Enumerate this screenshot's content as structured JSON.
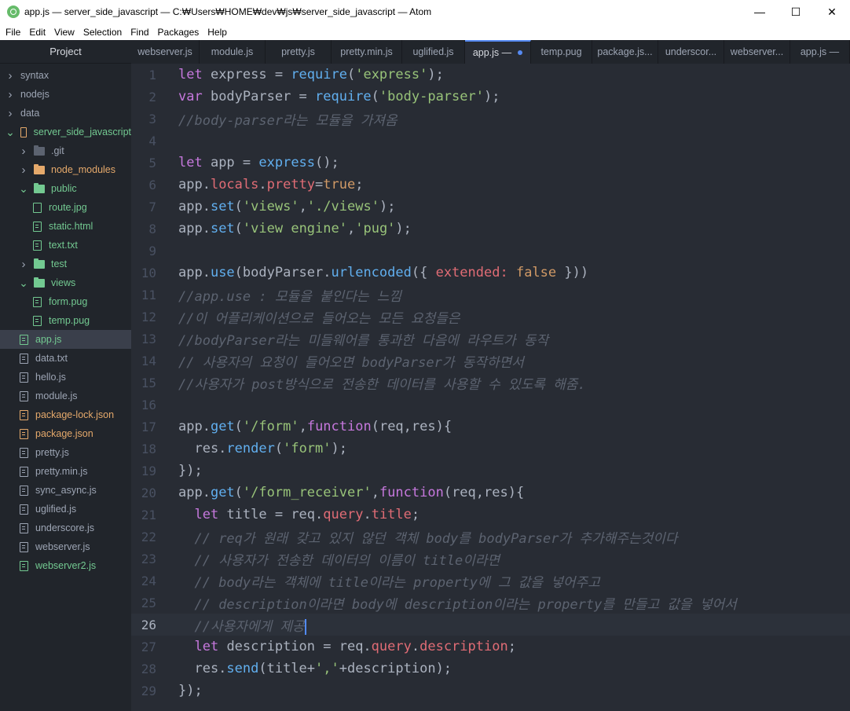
{
  "window": {
    "title": "app.js — server_side_javascript — C:₩Users₩HOME₩dev₩js₩server_side_javascript — Atom",
    "minimize": "—",
    "maximize": "☐",
    "close": "✕"
  },
  "menu": [
    "File",
    "Edit",
    "View",
    "Selection",
    "Find",
    "Packages",
    "Help"
  ],
  "tree": {
    "header": "Project",
    "items": [
      {
        "label": "syntax",
        "depth": 0,
        "type": "folder",
        "expanded": false
      },
      {
        "label": "nodejs",
        "depth": 0,
        "type": "folder",
        "expanded": false
      },
      {
        "label": "data",
        "depth": 0,
        "type": "folder",
        "expanded": false
      },
      {
        "label": "server_side_javascript",
        "depth": 0,
        "type": "repo",
        "expanded": true
      },
      {
        "label": ".git",
        "depth": 1,
        "type": "folder",
        "expanded": false
      },
      {
        "label": "node_modules",
        "depth": 1,
        "type": "folder",
        "expanded": false
      },
      {
        "label": "public",
        "depth": 1,
        "type": "folder",
        "expanded": true
      },
      {
        "label": "route.jpg",
        "depth": 2,
        "type": "image"
      },
      {
        "label": "static.html",
        "depth": 2,
        "type": "file"
      },
      {
        "label": "text.txt",
        "depth": 2,
        "type": "file"
      },
      {
        "label": "test",
        "depth": 1,
        "type": "folder",
        "expanded": false
      },
      {
        "label": "views",
        "depth": 1,
        "type": "folder",
        "expanded": true
      },
      {
        "label": "form.pug",
        "depth": 2,
        "type": "file"
      },
      {
        "label": "temp.pug",
        "depth": 2,
        "type": "file"
      },
      {
        "label": "app.js",
        "depth": 1,
        "type": "file",
        "selected": true
      },
      {
        "label": "data.txt",
        "depth": 1,
        "type": "file"
      },
      {
        "label": "hello.js",
        "depth": 1,
        "type": "file"
      },
      {
        "label": "module.js",
        "depth": 1,
        "type": "file"
      },
      {
        "label": "package-lock.json",
        "depth": 1,
        "type": "file"
      },
      {
        "label": "package.json",
        "depth": 1,
        "type": "file"
      },
      {
        "label": "pretty.js",
        "depth": 1,
        "type": "file"
      },
      {
        "label": "pretty.min.js",
        "depth": 1,
        "type": "file"
      },
      {
        "label": "sync_async.js",
        "depth": 1,
        "type": "file"
      },
      {
        "label": "uglified.js",
        "depth": 1,
        "type": "file"
      },
      {
        "label": "underscore.js",
        "depth": 1,
        "type": "file"
      },
      {
        "label": "webserver.js",
        "depth": 1,
        "type": "file"
      },
      {
        "label": "webserver2.js",
        "depth": 1,
        "type": "file"
      }
    ]
  },
  "tabs": [
    {
      "label": "webserver.js"
    },
    {
      "label": "module.js"
    },
    {
      "label": "pretty.js"
    },
    {
      "label": "pretty.min.js"
    },
    {
      "label": "uglified.js"
    },
    {
      "label": "app.js —",
      "active": true,
      "modified": true
    },
    {
      "label": "temp.pug"
    },
    {
      "label": "package.js..."
    },
    {
      "label": "underscor..."
    },
    {
      "label": "webserver..."
    },
    {
      "label": "app.js —"
    }
  ],
  "colors": {
    "keyword": "#c678dd",
    "function": "#61afef",
    "string": "#98c379",
    "property": "#e06c75",
    "boolean": "#d19a66",
    "comment": "#5c6370",
    "folder_green": "#73c991",
    "folder_orange": "#e5a96b",
    "accent": "#568af2"
  },
  "cursor_line": 26,
  "code": [
    [
      [
        "kw",
        "let"
      ],
      [
        "t",
        " express = "
      ],
      [
        "fn",
        "require"
      ],
      [
        "t",
        "("
      ],
      [
        "str",
        "'express'"
      ],
      [
        "t",
        ");"
      ]
    ],
    [
      [
        "kw",
        "var"
      ],
      [
        "t",
        " bodyParser = "
      ],
      [
        "fn",
        "require"
      ],
      [
        "t",
        "("
      ],
      [
        "str",
        "'body-parser'"
      ],
      [
        "t",
        ");"
      ]
    ],
    [
      [
        "cm",
        "//body-parser라는 모듈을 가져옴"
      ]
    ],
    [],
    [
      [
        "kw",
        "let"
      ],
      [
        "t",
        " app = "
      ],
      [
        "fn",
        "express"
      ],
      [
        "t",
        "();"
      ]
    ],
    [
      [
        "t",
        "app."
      ],
      [
        "prop",
        "locals"
      ],
      [
        "t",
        "."
      ],
      [
        "prop",
        "pretty"
      ],
      [
        "t",
        "="
      ],
      [
        "bool",
        "true"
      ],
      [
        "t",
        ";"
      ]
    ],
    [
      [
        "t",
        "app."
      ],
      [
        "fn",
        "set"
      ],
      [
        "t",
        "("
      ],
      [
        "str",
        "'views'"
      ],
      [
        "t",
        ","
      ],
      [
        "str",
        "'./views'"
      ],
      [
        "t",
        ");"
      ]
    ],
    [
      [
        "t",
        "app."
      ],
      [
        "fn",
        "set"
      ],
      [
        "t",
        "("
      ],
      [
        "str",
        "'view engine'"
      ],
      [
        "t",
        ","
      ],
      [
        "str",
        "'pug'"
      ],
      [
        "t",
        ");"
      ]
    ],
    [],
    [
      [
        "t",
        "app."
      ],
      [
        "fn",
        "use"
      ],
      [
        "t",
        "(bodyParser."
      ],
      [
        "fn",
        "urlencoded"
      ],
      [
        "t",
        "({ "
      ],
      [
        "prop",
        "extended:"
      ],
      [
        "t",
        " "
      ],
      [
        "bool",
        "false"
      ],
      [
        "t",
        " }))"
      ]
    ],
    [
      [
        "cm",
        "//app.use : 모듈을 붙인다는 느낌"
      ]
    ],
    [
      [
        "cm",
        "//이 어플리케이션으로 들어오는 모든 요청들은"
      ]
    ],
    [
      [
        "cm",
        "//bodyParser라는 미들웨어를 통과한 다음에 라우트가 동작"
      ]
    ],
    [
      [
        "cm",
        "// 사용자의 요청이 들어오면 bodyParser가 동작하면서"
      ]
    ],
    [
      [
        "cm",
        "//사용자가 post방식으로 전송한 데이터를 사용할 수 있도록 해줌."
      ]
    ],
    [],
    [
      [
        "t",
        "app."
      ],
      [
        "fn",
        "get"
      ],
      [
        "t",
        "("
      ],
      [
        "str",
        "'/form'"
      ],
      [
        "t",
        ","
      ],
      [
        "kw",
        "function"
      ],
      [
        "t",
        "(req,res){"
      ]
    ],
    [
      [
        "t",
        "  res."
      ],
      [
        "fn",
        "render"
      ],
      [
        "t",
        "("
      ],
      [
        "str",
        "'form'"
      ],
      [
        "t",
        ");"
      ]
    ],
    [
      [
        "t",
        "});"
      ]
    ],
    [
      [
        "t",
        "app."
      ],
      [
        "fn",
        "get"
      ],
      [
        "t",
        "("
      ],
      [
        "str",
        "'/form_receiver'"
      ],
      [
        "t",
        ","
      ],
      [
        "kw",
        "function"
      ],
      [
        "t",
        "(req,res){"
      ]
    ],
    [
      [
        "t",
        "  "
      ],
      [
        "kw",
        "let"
      ],
      [
        "t",
        " title = req."
      ],
      [
        "prop",
        "query"
      ],
      [
        "t",
        "."
      ],
      [
        "prop",
        "title"
      ],
      [
        "t",
        ";"
      ]
    ],
    [
      [
        "t",
        "  "
      ],
      [
        "cm",
        "// req가 원래 갖고 있지 않던 객체 body를 bodyParser가 추가해주는것이다"
      ]
    ],
    [
      [
        "t",
        "  "
      ],
      [
        "cm",
        "// 사용자가 전송한 데이터의 이름이 title이라면"
      ]
    ],
    [
      [
        "t",
        "  "
      ],
      [
        "cm",
        "// body라는 객체에 title이라는 property에 그 값을 넣어주고"
      ]
    ],
    [
      [
        "t",
        "  "
      ],
      [
        "cm",
        "// description이라면 body에 description이라는 property를 만들고 값을 넣어서"
      ]
    ],
    [
      [
        "t",
        "  "
      ],
      [
        "cm",
        "//사용자에게 제공"
      ]
    ],
    [
      [
        "t",
        "  "
      ],
      [
        "kw",
        "let"
      ],
      [
        "t",
        " description = req."
      ],
      [
        "prop",
        "query"
      ],
      [
        "t",
        "."
      ],
      [
        "prop",
        "description"
      ],
      [
        "t",
        ";"
      ]
    ],
    [
      [
        "t",
        "  res."
      ],
      [
        "fn",
        "send"
      ],
      [
        "t",
        "(title+"
      ],
      [
        "str",
        "','"
      ],
      [
        "t",
        "+description);"
      ]
    ],
    [
      [
        "t",
        "});"
      ]
    ]
  ]
}
